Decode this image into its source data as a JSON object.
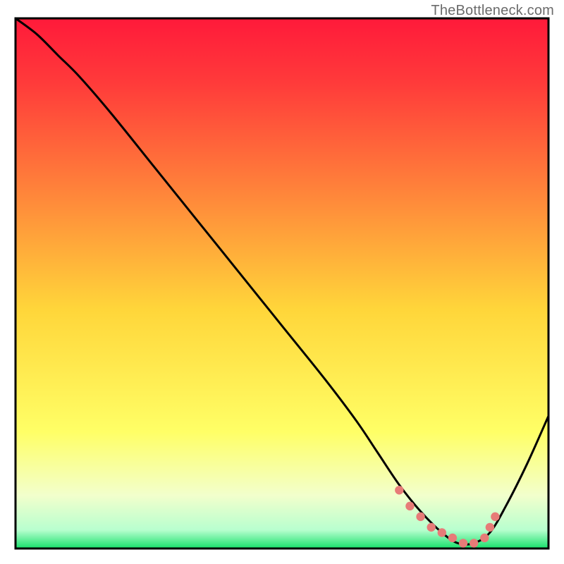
{
  "watermark": "TheBottleneck.com",
  "chart_data": {
    "type": "line",
    "title": "",
    "xlabel": "",
    "ylabel": "",
    "xlim": [
      0,
      100
    ],
    "ylim": [
      0,
      100
    ],
    "grid": false,
    "series": [
      {
        "name": "curve",
        "x": [
          0,
          4,
          8,
          12,
          18,
          26,
          34,
          42,
          50,
          58,
          64,
          68,
          72,
          76,
          80,
          83,
          86,
          89,
          92,
          96,
          100
        ],
        "y": [
          100,
          97,
          93,
          89,
          82,
          72,
          62,
          52,
          42,
          32,
          24,
          18,
          12,
          7,
          3,
          1,
          1,
          3,
          8,
          16,
          25
        ]
      }
    ],
    "highlight": {
      "name": "bottom-markers",
      "x": [
        72,
        74,
        76,
        78,
        80,
        82,
        84,
        86,
        88,
        89,
        90
      ],
      "y": [
        11,
        8,
        6,
        4,
        3,
        2,
        1,
        1,
        2,
        4,
        6
      ]
    },
    "gradient_colors": {
      "top": "#ff1a3a",
      "mid1": "#ff7a3a",
      "mid2": "#ffd63a",
      "low1": "#ffff66",
      "low2": "#f2ffcc",
      "bottom": "#16e06b"
    }
  }
}
